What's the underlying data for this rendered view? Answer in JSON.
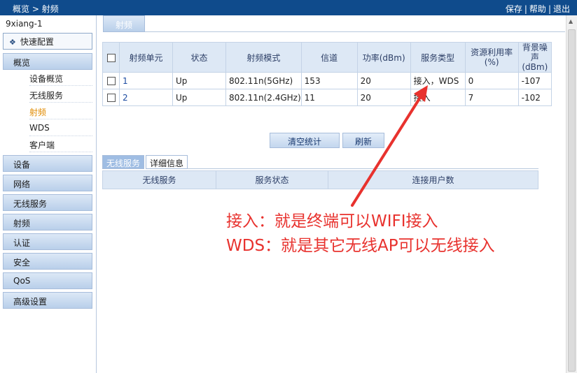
{
  "topbar": {
    "breadcrumb": "概览 > 射频",
    "save": "保存",
    "help": "帮助",
    "logout": "退出",
    "sep": "|"
  },
  "sidebar": {
    "device_name": "9xiang-1",
    "quick_config": "快速配置",
    "menu": [
      "概览",
      "设备",
      "网络",
      "无线服务",
      "射频",
      "认证",
      "安全",
      "QoS",
      "高级设置"
    ],
    "submenu": [
      "设备概览",
      "无线服务",
      "射频",
      "WDS",
      "客户端"
    ]
  },
  "main": {
    "tab": "射频",
    "columns": [
      "射频单元",
      "状态",
      "射频模式",
      "信道",
      "功率(dBm)",
      "服务类型",
      "资源利用率\n(%)",
      "背景噪声\n(dBm)"
    ],
    "rows": [
      {
        "unit": "1",
        "status": "Up",
        "mode": "802.11n(5GHz)",
        "channel": "153",
        "power": "20",
        "service": "接入，WDS",
        "util": "0",
        "noise": "-107"
      },
      {
        "unit": "2",
        "status": "Up",
        "mode": "802.11n(2.4GHz)",
        "channel": "11",
        "power": "20",
        "service": "接入",
        "util": "7",
        "noise": "-102"
      }
    ],
    "clear_stats": "清空统计",
    "refresh": "刷新",
    "subtabs": [
      "无线服务",
      "详细信息"
    ],
    "svc_columns": [
      "无线服务",
      "服务状态",
      "连接用户数"
    ]
  },
  "annotation": {
    "line1": "接入：就是终端可以WIFI接入",
    "line2": "WDS：就是其它无线AP可以无线接入",
    "color": "#e8322e"
  },
  "colors": {
    "topbar": "#0f4b8c",
    "menu_active_text": "#e08a00",
    "header_bg": "#dde8f5"
  }
}
